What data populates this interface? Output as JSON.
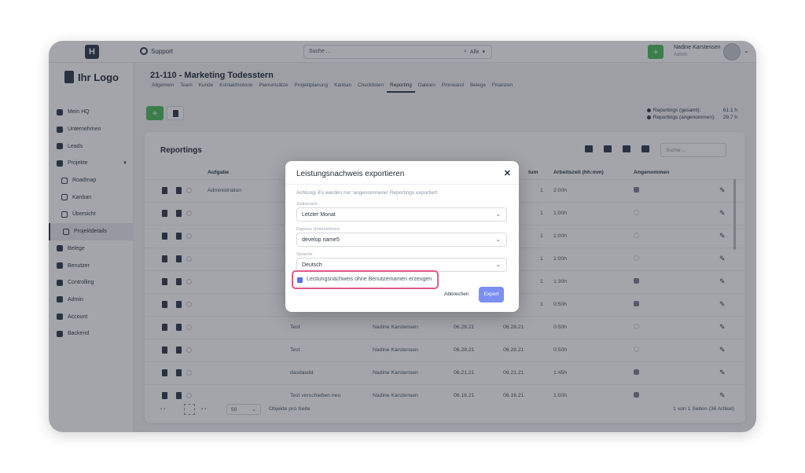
{
  "topbar": {
    "support": "Support",
    "search_placeholder": "Suche ...",
    "search_scope": "Alle",
    "user_name": "Nadine Karstensen",
    "user_role": "Admin"
  },
  "brand": "Ihr Logo",
  "sidebar": {
    "items": [
      {
        "label": "Mein HQ"
      },
      {
        "label": "Unternehmen"
      },
      {
        "label": "Leads"
      },
      {
        "label": "Projekte"
      },
      {
        "label": "Roadmap"
      },
      {
        "label": "Kanban"
      },
      {
        "label": "Übersicht"
      },
      {
        "label": "Projektdetails"
      },
      {
        "label": "Belege"
      },
      {
        "label": "Benutzer"
      },
      {
        "label": "Controlling"
      },
      {
        "label": "Admin"
      },
      {
        "label": "Account"
      },
      {
        "label": "Backend"
      }
    ]
  },
  "project": {
    "title": "21-110 - Marketing Todesstern",
    "tabs": [
      "Allgemein",
      "Team",
      "Kunde",
      "Kontakthistorie",
      "Planumsätze",
      "Projektplanung",
      "Kanban",
      "Checklisten",
      "Reporting",
      "Dateien",
      "Pinnwand",
      "Belege",
      "Finanzen"
    ]
  },
  "stats": {
    "total_label": "Reportings (gesamt):",
    "total_value": "61.1 h",
    "accepted_label": "Reportings (angenommen):",
    "accepted_value": "29.7 h"
  },
  "reportings": {
    "title": "Reportings",
    "search_placeholder": "Suche ...",
    "columns": {
      "task": "Aufgabe",
      "date_partial": "tum",
      "time": "Arbeitszeit (hh:mm)",
      "accepted": "Angenommen"
    },
    "rows": [
      {
        "task": "Administration",
        "desc": "",
        "user": "",
        "date1": "",
        "date2": "1",
        "time": "2:00h",
        "accepted": true
      },
      {
        "task": "",
        "desc": "",
        "user": "",
        "date1": "",
        "date2": "1",
        "time": "1:00h",
        "accepted": false
      },
      {
        "task": "",
        "desc": "",
        "user": "",
        "date1": "",
        "date2": "1",
        "time": "1:00h",
        "accepted": false
      },
      {
        "task": "",
        "desc": "",
        "user": "",
        "date1": "",
        "date2": "1",
        "time": "1:00h",
        "accepted": false
      },
      {
        "task": "",
        "desc": "",
        "user": "",
        "date1": "",
        "date2": "1",
        "time": "1:30h",
        "accepted": true
      },
      {
        "task": "",
        "desc": "",
        "user": "",
        "date1": "",
        "date2": "1",
        "time": "0:50h",
        "accepted": true
      },
      {
        "task": "",
        "desc": "Test",
        "user": "Nadine Karstensen",
        "date1": "06.28.21",
        "date2": "06.28.21",
        "time": "0:50h",
        "accepted": false
      },
      {
        "task": "",
        "desc": "Test",
        "user": "Nadine Karstensen",
        "date1": "06.28.21",
        "date2": "06.28.21",
        "time": "0:50h",
        "accepted": false
      },
      {
        "task": "",
        "desc": "dasdasdd",
        "user": "Nadine Karstensen",
        "date1": "06.21.21",
        "date2": "06.21.21",
        "time": "1:45h",
        "accepted": true
      },
      {
        "task": "",
        "desc": "Test verschieben neu",
        "user": "Nadine Karstensen",
        "date1": "06.16.21",
        "date2": "06.16.21",
        "time": "1:00h",
        "accepted": true
      }
    ],
    "pager": {
      "page_size": "50",
      "page_size_label": "Objekte pro Seite",
      "summary": "1 von 1 Seiten (36 Artikel)"
    }
  },
  "modal": {
    "title": "Leistungsnachweis exportieren",
    "close": "✕",
    "hint": "Achtung: Es werden nur 'angenommene' Reportings exportiert",
    "fields": [
      {
        "label": "Zeitbereich",
        "value": "Letzter Monat"
      },
      {
        "label": "Eigenes Unternehmen",
        "value": "develop name5"
      },
      {
        "label": "Sprache",
        "value": "Deutsch"
      }
    ],
    "checkbox_label": "Leistungsnachweis ohne Benutzernamen erzeugen",
    "checkbox_checked": true,
    "cancel": "Abbrechen",
    "export": "Export"
  },
  "colors": {
    "accent_green": "#4cbb5c",
    "highlight": "#e05a86",
    "primary_button": "#7b8ff2",
    "sidebar_dark": "#2f3a4c"
  }
}
